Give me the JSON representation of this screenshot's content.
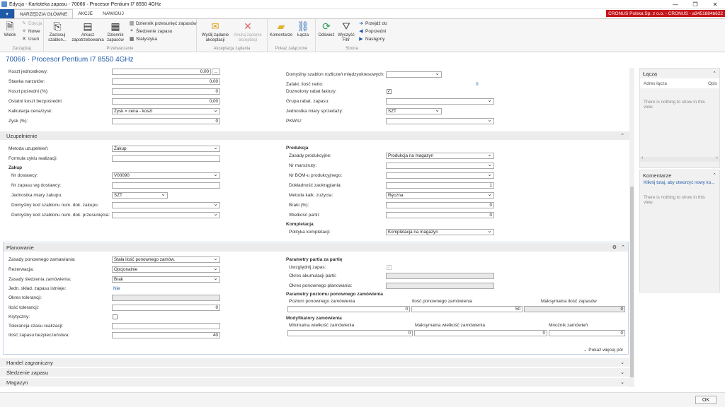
{
  "window": {
    "title": "Edycja - Kartoteka zapasu - 70066 · Procesor Pentium I7 8550 4GHz",
    "minimize": "—",
    "maximize": "❐",
    "close": "✕"
  },
  "tabs": [
    "NARZĘDZIA GŁÓWNE",
    "AKCJE",
    "NAWIGUJ"
  ],
  "company": "CRONUS Polska Sp. z o.o. - CRONUS - a3451884b622",
  "ribbon": {
    "widok": "Widok",
    "edycja": "Edycja",
    "nowe": "Nowe",
    "usun": "Usuń",
    "zarzadzaj": "Zarządzaj",
    "zastosuj": "Zastosuj szablon...",
    "arkusz": "Arkusz zapotrzebowania",
    "dziennik": "Dziennik zapasów",
    "dz_przes": "Dziennik przesunięć zapasów",
    "sledzenie": "Śledzenie zapasu",
    "statystyka": "Statystyka",
    "przetwarzanie": "Przetwarzanie",
    "wyslij": "Wyślij żądanie akceptacji",
    "anuluj": "Anuluj żądanie akceptacji",
    "akceptacja": "Akceptacja żądania",
    "komentarze": "Komentarze",
    "lacza": "Łącza",
    "pokaz": "Pokaż załączone",
    "odswiez": "Odśwież",
    "wyczysc": "Wyczyść Filtr",
    "przejdz": "Przejdź do",
    "poprzedni": "Poprzedni",
    "nastepny": "Następny",
    "strona": "Strona"
  },
  "page_title": "70066 · Procesor Pentium I7 8550 4GHz",
  "koszty": {
    "koszt_jedn": "Koszt jednostkowy:",
    "koszt_jedn_v": "0,00",
    "dots": "...",
    "stawka": "Stawka narzutów:",
    "stawka_v": "0,00",
    "posredni": "Koszt pośredni (%):",
    "posredni_v": "0",
    "ostatni": "Ostatni koszt bezpośredni:",
    "ostatni_v": "0,00",
    "kalk": "Kalkulacja cena/zysk:",
    "kalk_v": "Zysk = cena - koszt",
    "zysk": "Zysk (%):",
    "zysk_v": "0",
    "szablon_rozl": "Domyślny szablon rozliczeń międzyokresowych:",
    "szablon_rozl_v": "",
    "zafakt": "Zafakt. ilość netto:",
    "zafakt_v": "0",
    "rabat": "Dozwolony rabat faktury:",
    "rabat_v": "✓",
    "grupa_rabat": "Grupa rabat. zapasu:",
    "grupa_rabat_v": "",
    "jm_sprz": "Jednostka miary sprzedaży:",
    "jm_sprz_v": "SZT",
    "pkwiu": "PKWiU:",
    "pkwiu_v": ""
  },
  "uzup": {
    "header": "Uzupełnienie",
    "chev": "⌃",
    "metoda": "Metoda uzupełnień:",
    "metoda_v": "Zakup",
    "formula": "Formuła cyklu realizacji:",
    "formula_v": "",
    "zakup": "Zakup",
    "nr_dost": "Nr dostawcy:",
    "nr_dost_v": "V00090",
    "nr_zap_dost": "Nr zapasu wg dostawcy:",
    "nr_zap_dost_v": "",
    "jm_zak": "Jednostka miary zakupu:",
    "jm_zak_v": "SZT",
    "kod_zak": "Domyślny kod szablonu num. dok. zakupu:",
    "kod_zak_v": "",
    "kod_przes": "Domyślny kod szablonu num. dok. przesunięcia:",
    "kod_przes_v": "",
    "produkcja": "Produkcja",
    "zasady_prod": "Zasady produkcyjne:",
    "zasady_prod_v": "Produkcja na magazyn",
    "nr_marsz": "Nr marszruty:",
    "nr_marsz_v": "",
    "nr_bom": "Nr BOM-u produkcyjnego:",
    "nr_bom_v": "",
    "dokl": "Dokładność zaokrąglania:",
    "dokl_v": "1",
    "metoda_kalk": "Metoda kalk. zużycia:",
    "metoda_kalk_v": "Ręczna",
    "braki": "Braki (%):",
    "braki_v": "0",
    "wielk_partii": "Wielkość partii:",
    "wielk_partii_v": "0",
    "kompletacja": "Kompletacja",
    "polityka": "Polityka kompletacji:",
    "polityka_v": "Kompletacja na magazyn"
  },
  "plan": {
    "header": "Planowanie",
    "chev": "⌃",
    "gear": "⚙",
    "zasady_pon": "Zasady ponownego zamawiania:",
    "zasady_pon_v": "Stała ilość ponownego zamów.",
    "rezerwacja": "Rezerwacja:",
    "rezerwacja_v": "Opcjonalnie",
    "zasady_sled": "Zasady śledzenia zamówienia:",
    "zasady_sled_v": "Brak",
    "jedn_sklad": "Jedn. skład. zapasu istnieje:",
    "jedn_sklad_v": "Nie",
    "okres_tol": "Okres tolerancji:",
    "okres_tol_v": "",
    "ilosc_tol": "Ilość tolerancji:",
    "ilosc_tol_v": "0",
    "krytyczny": "Krytyczny:",
    "krytyczny_v": "",
    "tol_czasu": "Tolerancja czasu realizacji:",
    "tol_czasu_v": "",
    "zapas_bezp": "Ilość zapasu bezpieczeństwa:",
    "zapas_bezp_v": "40",
    "param_partia": "Parametry partia za partię",
    "uwzgl": "Uwzględnij zapas:",
    "uwzgl_v": "✓",
    "okres_akum": "Okres akumulacji partii:",
    "okres_akum_v": "",
    "okres_pon": "Okres ponownego planowania:",
    "okres_pon_v": "",
    "param_poziom": "Parametry poziomu ponownego zamówienia",
    "poziom": "Poziom ponownego zamówienia",
    "poziom_v": "0",
    "ilosc_pon": "Ilość ponownego zamówienia",
    "ilosc_pon_v": "50",
    "maks_zap": "Maksymalna ilość zapasów",
    "maks_zap_v": "0",
    "modyf": "Modyfikatory zamówienia",
    "min_wielk": "Minimalna wielkość zamówienia",
    "min_wielk_v": "0",
    "maks_wielk": "Maksymalna wielkość zamówienia",
    "maks_wielk_v": "0",
    "mnoznik": "Mnożnik zamówień",
    "mnoznik_v": "0",
    "pokaz_wiecej": "Pokaż więcej pól",
    "pokaz_chev": "⌄"
  },
  "sections": [
    {
      "label": "Handel zagraniczny",
      "chev": "⌄"
    },
    {
      "label": "Śledzenie zapasu",
      "chev": "⌄"
    },
    {
      "label": "Magazyn",
      "chev": "⌄"
    }
  ],
  "factbox": {
    "lacza": "Łącza",
    "adres": "Adres łącza",
    "opis": "Opis",
    "empty1": "There is nothing to show in this view.",
    "komentarze": "Komentarze",
    "klik": "Kliknij tutaj, aby utworzyć nowy ko...",
    "empty2": "There is nothing to show in this view.",
    "chev": "⌃",
    "left": "‹",
    "right": "›"
  },
  "ok": "OK"
}
